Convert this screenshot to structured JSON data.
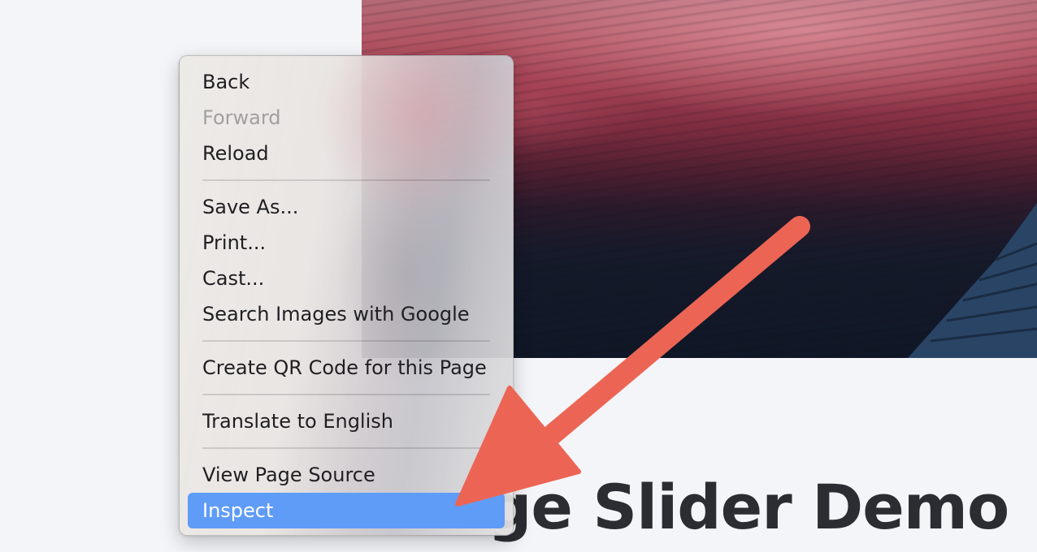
{
  "page": {
    "title": "ge Slider Demo"
  },
  "context_menu": {
    "groups": [
      {
        "items": [
          {
            "label": "Back",
            "enabled": true
          },
          {
            "label": "Forward",
            "enabled": false
          },
          {
            "label": "Reload",
            "enabled": true
          }
        ]
      },
      {
        "items": [
          {
            "label": "Save As...",
            "enabled": true
          },
          {
            "label": "Print...",
            "enabled": true
          },
          {
            "label": "Cast...",
            "enabled": true
          },
          {
            "label": "Search Images with Google",
            "enabled": true
          }
        ]
      },
      {
        "items": [
          {
            "label": "Create QR Code for this Page",
            "enabled": true
          }
        ]
      },
      {
        "items": [
          {
            "label": "Translate to English",
            "enabled": true
          }
        ]
      },
      {
        "items": [
          {
            "label": "View Page Source",
            "enabled": true
          },
          {
            "label": "Inspect",
            "enabled": true,
            "selected": true
          }
        ]
      }
    ]
  },
  "annotation": {
    "icon": "arrow-pointer-icon",
    "color": "#ec6554"
  },
  "colors": {
    "selection": "#5f9cf7",
    "disabled_text": "#a19f9f",
    "title_text": "#2c2d33",
    "background": "#f4f5f9"
  }
}
